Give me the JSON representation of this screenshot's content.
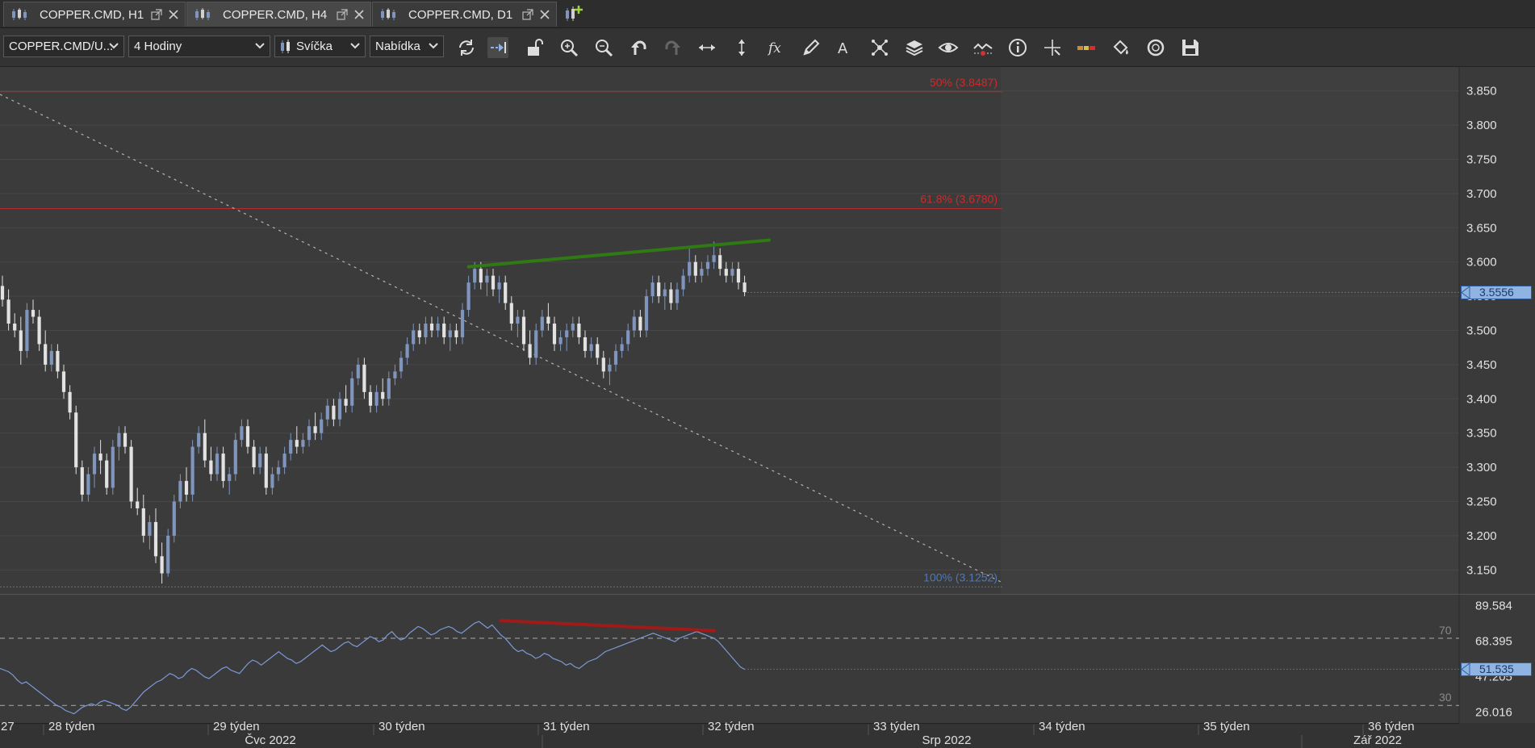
{
  "tabs": [
    {
      "label": "COPPER.CMD, H1",
      "active": false
    },
    {
      "label": "COPPER.CMD, H4",
      "active": true
    },
    {
      "label": "COPPER.CMD, D1",
      "active": false
    }
  ],
  "toolbar": {
    "instrument": "COPPER.CMD/U...",
    "period": "4 Hodiny",
    "chart_type": "Svíčka",
    "price_side": "Nabídka"
  },
  "colors": {
    "background": "#3a3a3a",
    "candle_up": "#7f95bd",
    "candle_down": "#e2e2e2",
    "fib_red": "#cc2b2b",
    "fib_blue": "#4f78b8",
    "trendline_green": "#2f7a14",
    "rsi_line": "#7c9ad6",
    "rsi_divergence_red": "#a11a1a"
  },
  "chart_data": {
    "type": "candlestick",
    "price_axis": {
      "ticks": [
        "3.850",
        "3.800",
        "3.750",
        "3.700",
        "3.650",
        "3.600",
        "3.550",
        "3.500",
        "3.450",
        "3.400",
        "3.350",
        "3.300",
        "3.250",
        "3.200",
        "3.150"
      ],
      "range": [
        3.115,
        3.885
      ]
    },
    "current_price": "3.5556",
    "fib_levels": [
      {
        "label": "50% (3.8487)",
        "value": 3.8487,
        "color": "red"
      },
      {
        "label": "61.8% (3.6780)",
        "value": 3.678,
        "color": "red"
      },
      {
        "label": "100% (3.1252)",
        "value": 3.1252,
        "color": "blue"
      }
    ],
    "week_labels": [
      "27",
      "28 týden",
      "29 týden",
      "30 týden",
      "31 týden",
      "32 týden",
      "33 týden",
      "34 týden",
      "35 týden",
      "36 týden"
    ],
    "month_labels": [
      "Čvc 2022",
      "Srp 2022",
      "Zář 2022"
    ],
    "candles": [
      [
        3.565,
        3.58,
        3.535,
        3.545
      ],
      [
        3.545,
        3.56,
        3.5,
        3.51
      ],
      [
        3.51,
        3.525,
        3.49,
        3.5
      ],
      [
        3.5,
        3.52,
        3.45,
        3.47
      ],
      [
        3.47,
        3.54,
        3.46,
        3.53
      ],
      [
        3.53,
        3.545,
        3.51,
        3.52
      ],
      [
        3.52,
        3.53,
        3.47,
        3.48
      ],
      [
        3.48,
        3.5,
        3.44,
        3.45
      ],
      [
        3.45,
        3.48,
        3.44,
        3.47
      ],
      [
        3.47,
        3.48,
        3.43,
        3.44
      ],
      [
        3.44,
        3.45,
        3.4,
        3.41
      ],
      [
        3.41,
        3.42,
        3.37,
        3.38
      ],
      [
        3.38,
        3.39,
        3.29,
        3.3
      ],
      [
        3.3,
        3.31,
        3.25,
        3.26
      ],
      [
        3.26,
        3.3,
        3.25,
        3.29
      ],
      [
        3.29,
        3.33,
        3.27,
        3.32
      ],
      [
        3.32,
        3.34,
        3.29,
        3.31
      ],
      [
        3.31,
        3.32,
        3.26,
        3.27
      ],
      [
        3.27,
        3.34,
        3.26,
        3.33
      ],
      [
        3.33,
        3.36,
        3.31,
        3.35
      ],
      [
        3.35,
        3.36,
        3.32,
        3.33
      ],
      [
        3.33,
        3.34,
        3.24,
        3.25
      ],
      [
        3.25,
        3.27,
        3.23,
        3.24
      ],
      [
        3.24,
        3.26,
        3.19,
        3.2
      ],
      [
        3.2,
        3.23,
        3.18,
        3.22
      ],
      [
        3.22,
        3.24,
        3.16,
        3.17
      ],
      [
        3.17,
        3.19,
        3.13,
        3.145
      ],
      [
        3.145,
        3.21,
        3.14,
        3.2
      ],
      [
        3.2,
        3.26,
        3.19,
        3.25
      ],
      [
        3.25,
        3.29,
        3.24,
        3.28
      ],
      [
        3.28,
        3.3,
        3.25,
        3.26
      ],
      [
        3.26,
        3.34,
        3.25,
        3.33
      ],
      [
        3.33,
        3.36,
        3.32,
        3.35
      ],
      [
        3.35,
        3.37,
        3.3,
        3.31
      ],
      [
        3.31,
        3.33,
        3.28,
        3.29
      ],
      [
        3.29,
        3.33,
        3.28,
        3.32
      ],
      [
        3.32,
        3.33,
        3.27,
        3.28
      ],
      [
        3.28,
        3.3,
        3.26,
        3.29
      ],
      [
        3.29,
        3.35,
        3.28,
        3.34
      ],
      [
        3.34,
        3.37,
        3.33,
        3.36
      ],
      [
        3.36,
        3.37,
        3.32,
        3.33
      ],
      [
        3.33,
        3.34,
        3.29,
        3.3
      ],
      [
        3.3,
        3.33,
        3.29,
        3.32
      ],
      [
        3.32,
        3.33,
        3.26,
        3.27
      ],
      [
        3.27,
        3.3,
        3.26,
        3.29
      ],
      [
        3.29,
        3.31,
        3.28,
        3.3
      ],
      [
        3.3,
        3.33,
        3.29,
        3.32
      ],
      [
        3.32,
        3.35,
        3.31,
        3.34
      ],
      [
        3.34,
        3.36,
        3.32,
        3.33
      ],
      [
        3.33,
        3.35,
        3.32,
        3.34
      ],
      [
        3.34,
        3.37,
        3.33,
        3.36
      ],
      [
        3.36,
        3.38,
        3.34,
        3.35
      ],
      [
        3.35,
        3.38,
        3.34,
        3.37
      ],
      [
        3.37,
        3.4,
        3.36,
        3.39
      ],
      [
        3.39,
        3.4,
        3.36,
        3.37
      ],
      [
        3.37,
        3.41,
        3.36,
        3.4
      ],
      [
        3.4,
        3.42,
        3.38,
        3.39
      ],
      [
        3.39,
        3.44,
        3.38,
        3.43
      ],
      [
        3.43,
        3.46,
        3.42,
        3.45
      ],
      [
        3.45,
        3.46,
        3.4,
        3.41
      ],
      [
        3.41,
        3.42,
        3.38,
        3.39
      ],
      [
        3.39,
        3.42,
        3.38,
        3.41
      ],
      [
        3.41,
        3.43,
        3.39,
        3.4
      ],
      [
        3.4,
        3.44,
        3.39,
        3.43
      ],
      [
        3.43,
        3.45,
        3.42,
        3.44
      ],
      [
        3.44,
        3.47,
        3.43,
        3.46
      ],
      [
        3.46,
        3.49,
        3.45,
        3.48
      ],
      [
        3.48,
        3.51,
        3.47,
        3.5
      ],
      [
        3.5,
        3.51,
        3.48,
        3.49
      ],
      [
        3.49,
        3.52,
        3.48,
        3.51
      ],
      [
        3.51,
        3.52,
        3.49,
        3.5
      ],
      [
        3.5,
        3.52,
        3.49,
        3.51
      ],
      [
        3.51,
        3.52,
        3.48,
        3.49
      ],
      [
        3.49,
        3.51,
        3.47,
        3.5
      ],
      [
        3.5,
        3.51,
        3.48,
        3.49
      ],
      [
        3.49,
        3.54,
        3.48,
        3.53
      ],
      [
        3.53,
        3.58,
        3.52,
        3.57
      ],
      [
        3.57,
        3.6,
        3.56,
        3.59
      ],
      [
        3.59,
        3.6,
        3.56,
        3.57
      ],
      [
        3.57,
        3.59,
        3.55,
        3.58
      ],
      [
        3.58,
        3.59,
        3.55,
        3.56
      ],
      [
        3.56,
        3.58,
        3.54,
        3.57
      ],
      [
        3.57,
        3.58,
        3.53,
        3.54
      ],
      [
        3.54,
        3.55,
        3.5,
        3.51
      ],
      [
        3.51,
        3.53,
        3.49,
        3.52
      ],
      [
        3.52,
        3.53,
        3.47,
        3.48
      ],
      [
        3.48,
        3.5,
        3.45,
        3.46
      ],
      [
        3.46,
        3.51,
        3.45,
        3.5
      ],
      [
        3.5,
        3.53,
        3.49,
        3.52
      ],
      [
        3.52,
        3.54,
        3.5,
        3.51
      ],
      [
        3.51,
        3.52,
        3.47,
        3.48
      ],
      [
        3.48,
        3.5,
        3.47,
        3.49
      ],
      [
        3.49,
        3.51,
        3.47,
        3.5
      ],
      [
        3.5,
        3.52,
        3.49,
        3.51
      ],
      [
        3.51,
        3.52,
        3.48,
        3.49
      ],
      [
        3.49,
        3.5,
        3.46,
        3.47
      ],
      [
        3.47,
        3.49,
        3.46,
        3.48
      ],
      [
        3.48,
        3.49,
        3.45,
        3.46
      ],
      [
        3.46,
        3.47,
        3.43,
        3.44
      ],
      [
        3.44,
        3.46,
        3.42,
        3.45
      ],
      [
        3.45,
        3.48,
        3.44,
        3.47
      ],
      [
        3.47,
        3.49,
        3.46,
        3.48
      ],
      [
        3.48,
        3.51,
        3.47,
        3.5
      ],
      [
        3.5,
        3.53,
        3.49,
        3.52
      ],
      [
        3.52,
        3.53,
        3.49,
        3.5
      ],
      [
        3.5,
        3.56,
        3.49,
        3.55
      ],
      [
        3.55,
        3.58,
        3.54,
        3.57
      ],
      [
        3.57,
        3.58,
        3.54,
        3.55
      ],
      [
        3.55,
        3.57,
        3.53,
        3.56
      ],
      [
        3.56,
        3.57,
        3.53,
        3.54
      ],
      [
        3.54,
        3.57,
        3.53,
        3.56
      ],
      [
        3.56,
        3.59,
        3.55,
        3.58
      ],
      [
        3.58,
        3.62,
        3.57,
        3.6
      ],
      [
        3.6,
        3.61,
        3.57,
        3.58
      ],
      [
        3.58,
        3.6,
        3.57,
        3.59
      ],
      [
        3.59,
        3.61,
        3.58,
        3.6
      ],
      [
        3.6,
        3.63,
        3.59,
        3.61
      ],
      [
        3.61,
        3.62,
        3.58,
        3.59
      ],
      [
        3.59,
        3.6,
        3.57,
        3.58
      ],
      [
        3.58,
        3.6,
        3.57,
        3.59
      ],
      [
        3.59,
        3.6,
        3.56,
        3.57
      ],
      [
        3.57,
        3.58,
        3.55,
        3.556
      ]
    ],
    "trendline_price": {
      "from_index": 76,
      "from_value": 3.593,
      "to_index": 125,
      "to_value": 3.632
    },
    "rsi": {
      "axis_ticks": [
        "89.584",
        "68.395",
        "47.205",
        "26.016"
      ],
      "range": [
        20,
        95
      ],
      "levels": [
        "70",
        "30"
      ],
      "current": "51.535",
      "values": [
        52,
        51,
        50,
        48,
        45,
        43,
        44,
        42,
        40,
        38,
        36,
        34,
        32,
        30,
        29,
        27,
        26,
        25,
        27,
        29,
        30,
        31,
        30,
        32,
        33,
        32,
        31,
        30,
        28,
        27,
        29,
        32,
        35,
        38,
        40,
        42,
        44,
        45,
        47,
        49,
        48,
        46,
        47,
        50,
        52,
        51,
        49,
        47,
        46,
        48,
        50,
        52,
        53,
        51,
        50,
        49,
        52,
        55,
        57,
        56,
        54,
        56,
        58,
        60,
        62,
        60,
        58,
        57,
        55,
        56,
        58,
        60,
        62,
        64,
        66,
        64,
        62,
        63,
        65,
        67,
        68,
        66,
        65,
        67,
        69,
        71,
        70,
        68,
        69,
        72,
        74,
        71,
        69,
        70,
        73,
        75,
        77,
        76,
        74,
        72,
        73,
        75,
        76,
        77,
        76,
        74,
        73,
        75,
        77,
        79,
        80,
        78,
        76,
        78,
        75,
        72,
        70,
        67,
        64,
        62,
        63,
        61,
        60,
        58,
        59,
        61,
        60,
        58,
        57,
        56,
        54,
        55,
        53,
        52,
        54,
        56,
        57,
        58,
        60,
        62,
        63,
        64,
        65,
        66,
        67,
        68,
        69,
        70,
        71,
        72,
        73,
        72,
        71,
        70,
        69,
        68,
        70,
        71,
        72,
        73,
        74,
        73,
        72,
        71,
        70,
        68,
        65,
        62,
        59,
        56,
        53,
        51.5
      ]
    },
    "divergence_rsi": {
      "from_index": 115,
      "from_value": 80.5,
      "to_index": 164,
      "to_value": 74.5
    }
  }
}
